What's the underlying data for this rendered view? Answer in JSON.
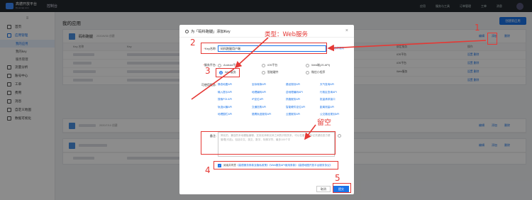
{
  "topbar": {
    "brand": "高德开放平台",
    "brand_sub": "lbs.amap.com",
    "console": "控制台",
    "nav": [
      "应用",
      "服务与工具",
      "订单管理",
      "工单",
      "消息"
    ]
  },
  "sidebar": {
    "collapse": "≡",
    "items": [
      {
        "label": "首页"
      },
      {
        "label": "应用管理",
        "active": true
      },
      {
        "label": "流量分析"
      },
      {
        "label": "账号中心"
      },
      {
        "label": "工单"
      },
      {
        "label": "费用"
      },
      {
        "label": "消息"
      },
      {
        "label": "自定义地图"
      },
      {
        "label": "数据可视化"
      }
    ],
    "subs": [
      "我的应用",
      "我的key",
      "服务管理"
    ]
  },
  "main": {
    "title": "我的应用",
    "create_button": "创建新应用",
    "app1": {
      "name": "码科跑腿",
      "date": "2020/6/30 创建",
      "actions": [
        "编辑",
        "添加",
        "删除"
      ],
      "table_headers": [
        "Key 名称",
        "Key",
        "绑定服务",
        "操作"
      ],
      "rows": [
        {
          "platform": "iOS平台",
          "ops": "设置 删除"
        },
        {
          "platform": "iOS平台",
          "ops": "设置 删除"
        },
        {
          "platform": "Web服务",
          "ops": "设置 删除"
        },
        {
          "platform": "",
          "ops": "设置 删除"
        }
      ]
    },
    "app2": {
      "date": "2020/7/10 创建",
      "actions": [
        "编辑",
        "添加",
        "删除"
      ]
    },
    "app3": {
      "actions": [
        "编辑",
        "添加",
        "删除"
      ]
    }
  },
  "modal": {
    "title": "为「码科跑腿」添加Key",
    "close": "×",
    "key_name_label": "Key名称:",
    "key_name_value": "码科跑腿用户端",
    "key_name_hint": "⊙ 名称规则",
    "platform_label": "服务平台:",
    "platforms": [
      "Android平台",
      "iOS平台",
      "Web端(JS API)",
      "Web服务",
      "智能硬件",
      "微信小程序"
    ],
    "selected_platform": "Web服务",
    "services_label": "可使用服务:",
    "services": [
      "静态地图API",
      "坐标转换API",
      "路径规划API",
      "天气查询API",
      "输入提示API",
      "地理编码API",
      "逆地理编码API",
      "行政区查询API",
      "搜索POI API",
      "IP定位API",
      "抓路服务API",
      "批量请求接口",
      "轨迹纠偏API",
      "交通态势API",
      "智能硬件定位API",
      "距离测量API",
      "地理围栏API",
      "猎鹰轨迹服务API",
      "云图服务API",
      "公交路径规划API"
    ],
    "remark_label": "备注:",
    "remark_placeholder": "简化的、兼容的本地模板编辑，支持实体和实体之间的识别关系，可以在备注中标记关键信息方便管理(可选)，包括中文、英文、数字、特殊字符、最多100个字",
    "agree_text": "阅读并同意",
    "agree_link": "《高德服务条款及隐私政策》《Web服务API使用条款》《高德地图开放平台服务协议》",
    "cancel": "取消",
    "submit": "提交"
  },
  "annotations": {
    "step1": "1",
    "step2": "2",
    "step3": "3",
    "step4": "4",
    "step5": "5",
    "type_label": "类型：Web服务",
    "remark_note": "留空",
    "color": "#e53935"
  }
}
